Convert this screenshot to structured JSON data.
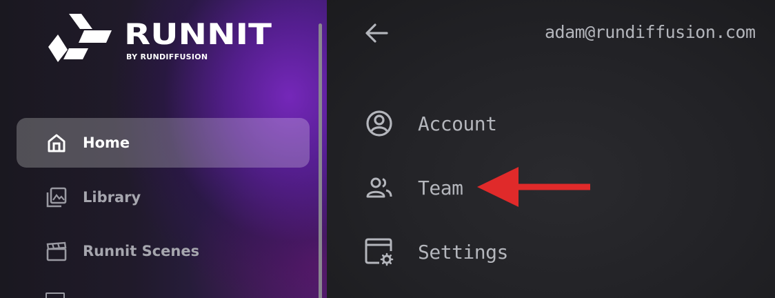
{
  "brand": {
    "name": "RUNNIT",
    "sub": "BY RUNDIFFUSION"
  },
  "sidebar": {
    "items": [
      {
        "label": "Home",
        "icon": "home-icon",
        "active": true
      },
      {
        "label": "Library",
        "icon": "gallery-icon",
        "active": false
      },
      {
        "label": "Runnit Scenes",
        "icon": "clapperboard-icon",
        "active": false
      }
    ]
  },
  "header": {
    "email": "adam@rundiffusion.com"
  },
  "menu": {
    "items": [
      {
        "label": "Account",
        "icon": "account-circle-icon"
      },
      {
        "label": "Team",
        "icon": "team-icon"
      },
      {
        "label": "Settings",
        "icon": "window-settings-icon"
      }
    ]
  },
  "colors": {
    "annotation_arrow": "#e02a2a",
    "sidebar_accent": "#5a22a0",
    "text_muted": "#b4b6bc"
  }
}
